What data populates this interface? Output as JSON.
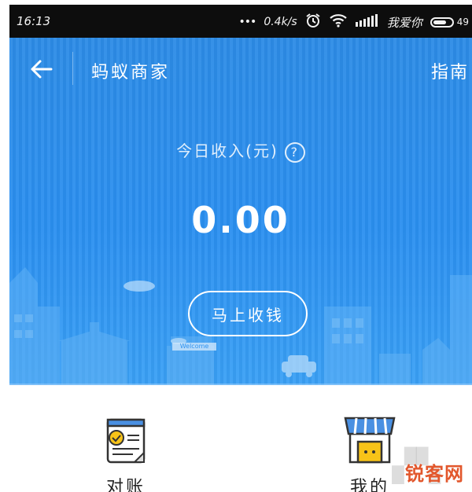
{
  "status_bar": {
    "time": "16:13",
    "speed": "0.4k/s",
    "carrier": "我爱你",
    "battery": "49"
  },
  "nav": {
    "title": "蚂蚁商家",
    "guide": "指南"
  },
  "income": {
    "label": "今日收入(元)",
    "help": "?",
    "amount": "0.00"
  },
  "collect_button": "马上收钱",
  "scene": {
    "welcome_sign": "Welcome"
  },
  "tiles": [
    {
      "label": "对账",
      "icon": "bill-check-icon"
    },
    {
      "label": "我的",
      "icon": "shop-icon"
    }
  ],
  "watermark": "锐客网",
  "colors": {
    "hero_blue": "#2a8ff0",
    "accent_orange": "#e2572c"
  }
}
